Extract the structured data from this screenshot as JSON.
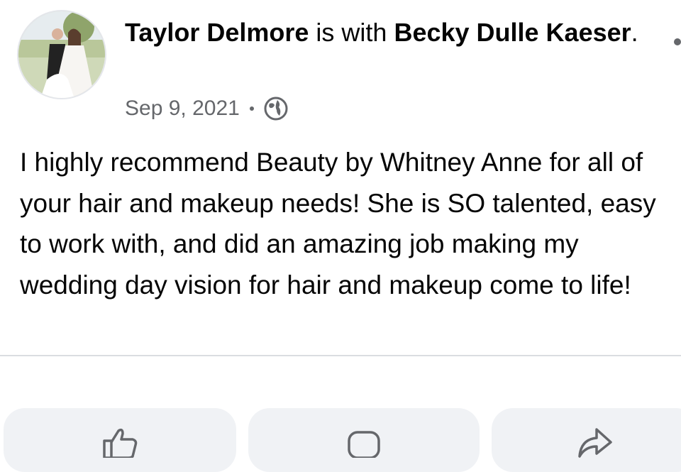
{
  "post": {
    "author": "Taylor Delmore",
    "with_text": " is with ",
    "tagged": "Becky Dulle Kaeser",
    "period": ".",
    "date": "Sep 9, 2021",
    "privacy_icon": "globe-icon",
    "body": "I highly recommend Beauty by Whitney Anne for all of your hair and makeup needs! She is SO talented, easy to work with, and did an amazing job making my wedding day vision for hair and makeup come to life!"
  },
  "actions": {
    "like_icon": "thumbs-up-icon",
    "comment_icon": "comment-icon",
    "share_icon": "share-icon"
  },
  "colors": {
    "text": "#050505",
    "secondary": "#65676b",
    "button_bg": "#f0f2f5",
    "divider": "#dadde1"
  }
}
